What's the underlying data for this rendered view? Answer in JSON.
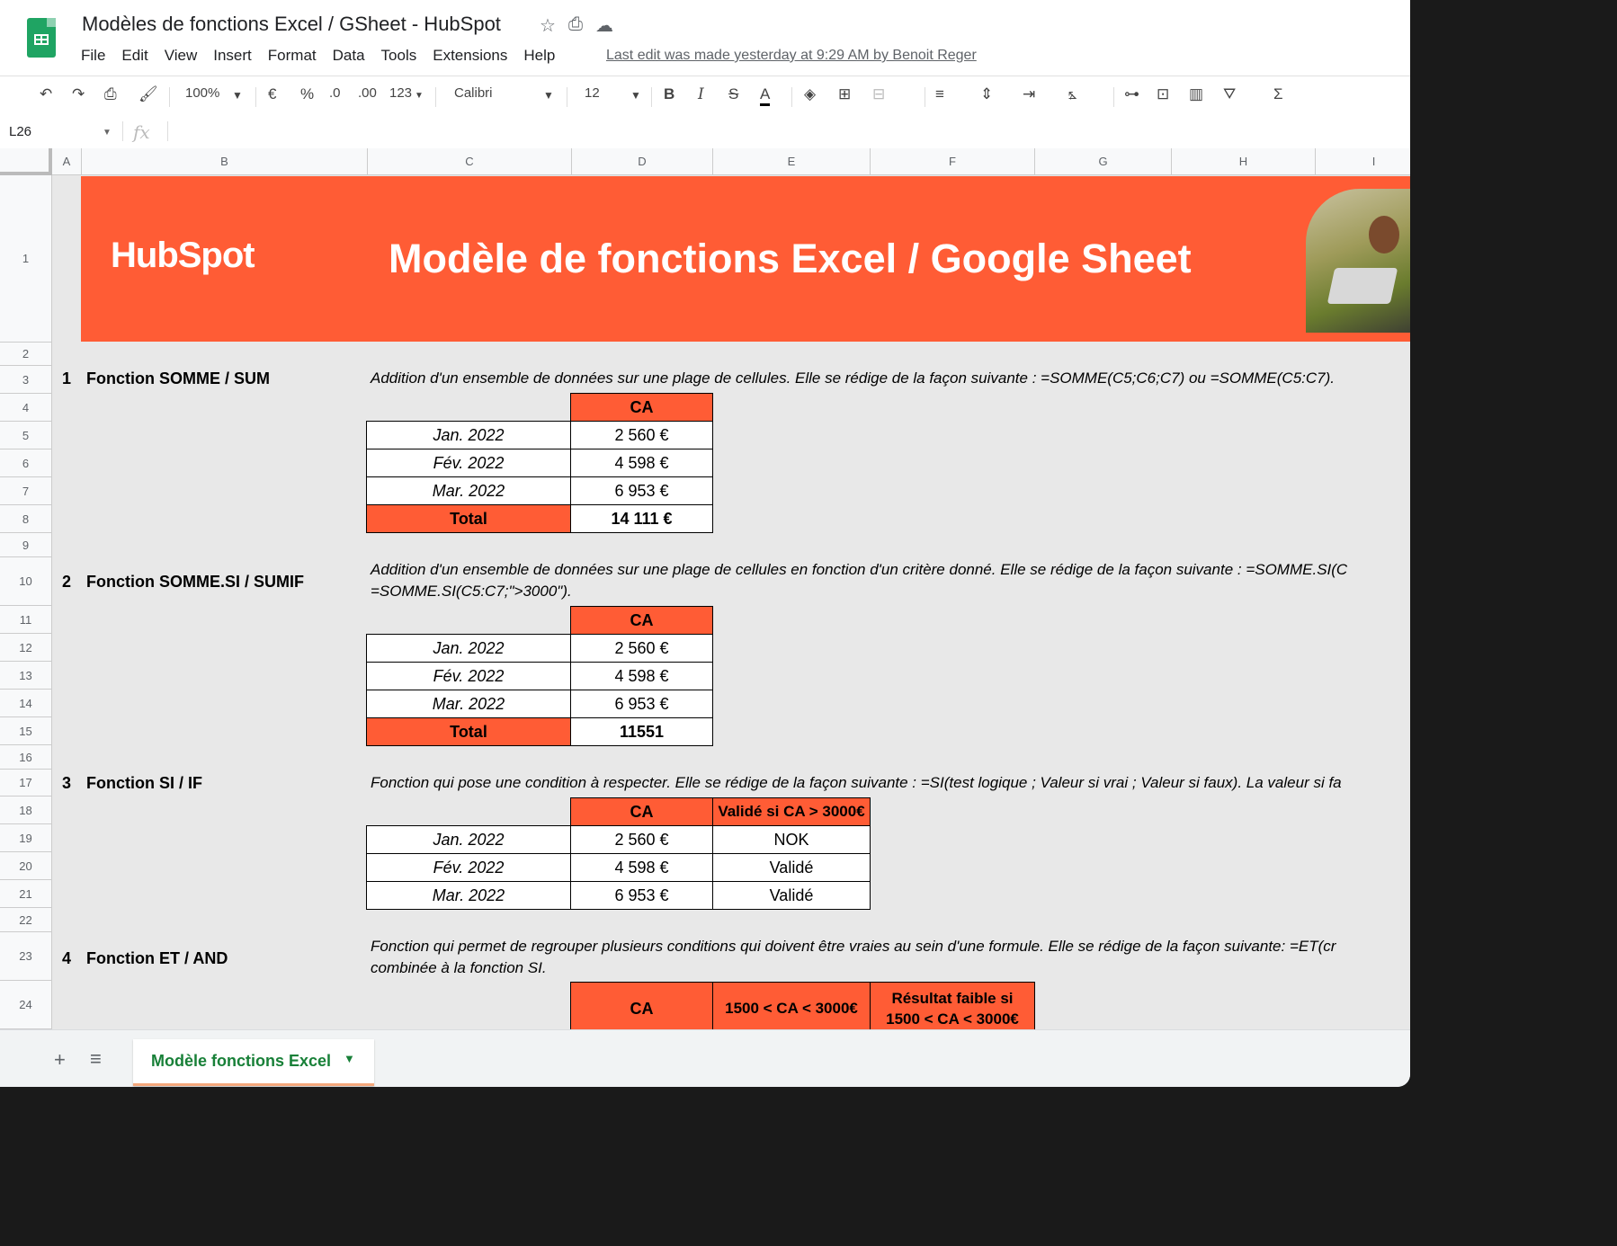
{
  "app": {
    "title": "Modèles de fonctions Excel / GSheet - HubSpot",
    "menu": [
      "File",
      "Edit",
      "View",
      "Insert",
      "Format",
      "Data",
      "Tools",
      "Extensions",
      "Help"
    ],
    "last_edit": "Last edit was made yesterday at 9:29 AM by Benoit Reger",
    "icons": [
      "star-icon",
      "move-to-drive-icon",
      "cloud-status-icon"
    ]
  },
  "toolbar": {
    "zoom": "100%",
    "currency": "€",
    "percent": "%",
    "dec_decrease": ".0",
    "dec_increase": ".00",
    "format_more": "123",
    "font": "Calibri",
    "font_size": "12",
    "bold": "B",
    "italic": "I",
    "strike": "S",
    "text_color": "A",
    "sum": "Σ"
  },
  "formula_bar": {
    "name_box": "L26",
    "fx": "fx",
    "value": ""
  },
  "columns": [
    "A",
    "B",
    "C",
    "D",
    "E",
    "F",
    "G",
    "H",
    "I"
  ],
  "rows": [
    "1",
    "2",
    "3",
    "4",
    "5",
    "6",
    "7",
    "8",
    "9",
    "10",
    "11",
    "12",
    "13",
    "14",
    "15",
    "16",
    "17",
    "18",
    "19",
    "20",
    "21",
    "22",
    "23",
    "24"
  ],
  "banner": {
    "logo": "HubSpot",
    "title": "Modèle de fonctions Excel / Google Sheet",
    "color": "#ff5c35"
  },
  "sections": [
    {
      "num": "1",
      "title": "Fonction SOMME / SUM",
      "desc": "Addition d'un ensemble de données sur une plage de cellules. Elle se rédige de la façon suivante : =SOMME(C5;C6;C7) ou =SOMME(C5:C7).",
      "header": "CA",
      "rows": [
        {
          "label": "Jan. 2022",
          "value": "2 560 €"
        },
        {
          "label": "Fév. 2022",
          "value": "4 598 €"
        },
        {
          "label": "Mar. 2022",
          "value": "6 953 €"
        }
      ],
      "total_label": "Total",
      "total_value": "14 111 €"
    },
    {
      "num": "2",
      "title": "Fonction SOMME.SI / SUMIF",
      "desc_line1": "Addition d'un ensemble de données sur une plage de cellules en fonction d'un critère donné. Elle se rédige de la façon suivante : =SOMME.SI(C",
      "desc_line2": "=SOMME.SI(C5:C7;\">3000\").",
      "header": "CA",
      "rows": [
        {
          "label": "Jan. 2022",
          "value": "2 560 €"
        },
        {
          "label": "Fév. 2022",
          "value": "4 598 €"
        },
        {
          "label": "Mar. 2022",
          "value": "6 953 €"
        }
      ],
      "total_label": "Total",
      "total_value": "11551"
    },
    {
      "num": "3",
      "title": "Fonction SI / IF",
      "desc": "Fonction qui pose une condition à respecter. Elle se rédige de la façon suivante : =SI(test logique ; Valeur si vrai ; Valeur si faux). La valeur si fa",
      "header": "CA",
      "header2": "Validé si CA > 3000€",
      "rows": [
        {
          "label": "Jan. 2022",
          "value": "2 560 €",
          "status": "NOK"
        },
        {
          "label": "Fév. 2022",
          "value": "4 598 €",
          "status": "Validé"
        },
        {
          "label": "Mar. 2022",
          "value": "6 953 €",
          "status": "Validé"
        }
      ]
    },
    {
      "num": "4",
      "title": "Fonction ET / AND",
      "desc_line1": "Fonction qui permet de regrouper plusieurs conditions qui doivent être vraies au sein d'une formule. Elle se rédige de la façon suivante: =ET(cr",
      "desc_line2": "combinée à la fonction SI.",
      "header": "CA",
      "header2": "1500 < CA < 3000€",
      "header3_line1": "Résultat faible si",
      "header3_line2": "1500 < CA < 3000€"
    }
  ],
  "sheet_tabs": {
    "add": "+",
    "all": "≡",
    "active": "Modèle fonctions Excel"
  }
}
